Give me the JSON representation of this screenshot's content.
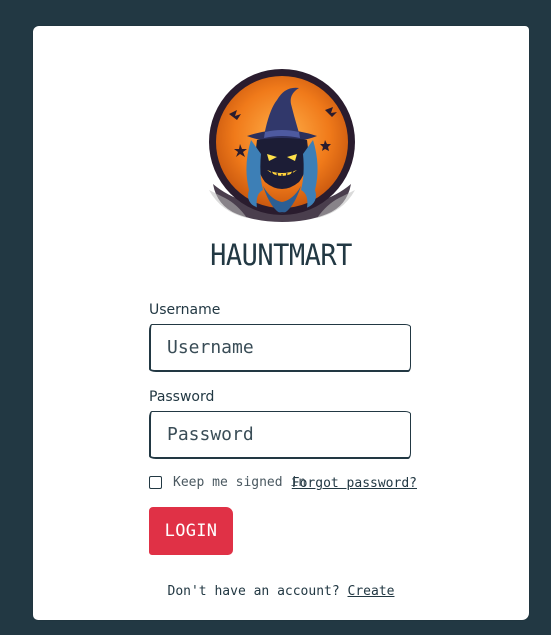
{
  "brand": {
    "name": "HAUNTMART",
    "logo_icon": "witch-skull-icon"
  },
  "form": {
    "username": {
      "label": "Username",
      "placeholder": "Username",
      "value": ""
    },
    "password": {
      "label": "Password",
      "placeholder": "Password",
      "value": ""
    },
    "remember": {
      "label": "Keep me signed in",
      "checked": false
    },
    "forgot_label": "Forgot password?",
    "login_label": "LOGIN"
  },
  "signup": {
    "prompt": "Don't have an account?",
    "link_label": "Create"
  },
  "colors": {
    "background": "#223843",
    "card": "#ffffff",
    "accent": "#e03146",
    "logo_orange": "#f07a1a",
    "text": "#223843"
  }
}
